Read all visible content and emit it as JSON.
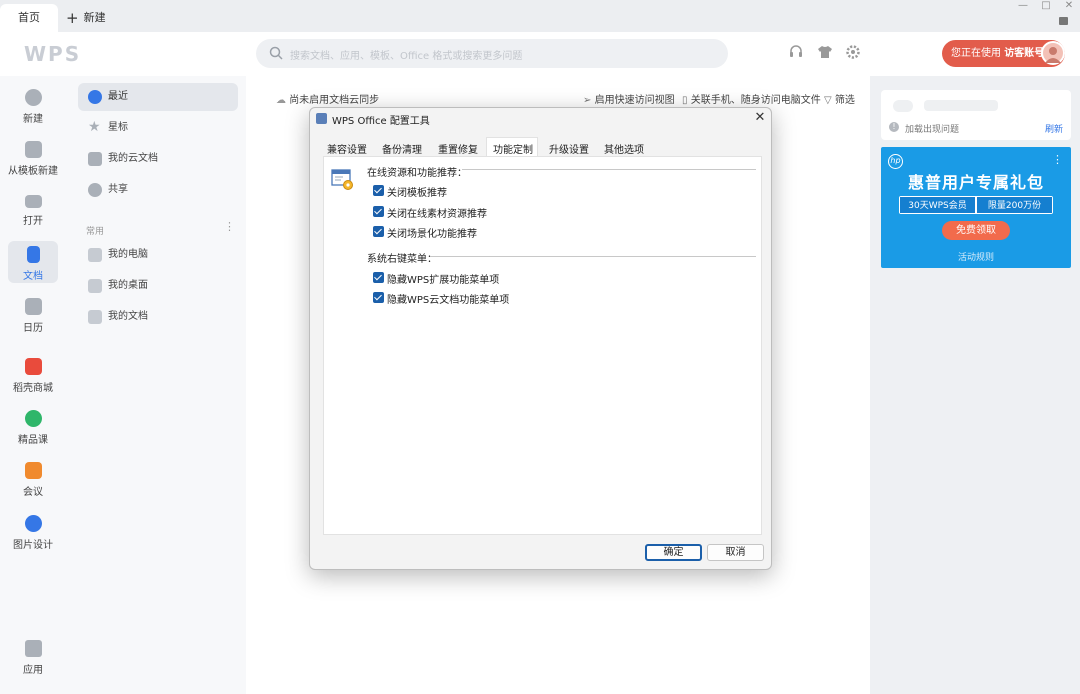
{
  "tabs": {
    "home": "首页",
    "new": "新建"
  },
  "header": {
    "logo": "WPS",
    "search_placeholder": "搜索文档、应用、模板、Office 格式或搜索更多问题",
    "user_status": "您正在使用",
    "user_account": "访客账号"
  },
  "rail": {
    "items": [
      {
        "label": "新建",
        "color": "#aab0b8"
      },
      {
        "label": "从模板新建",
        "color": "#aab0b8"
      },
      {
        "label": "打开",
        "color": "#aab0b8"
      },
      {
        "label": "文档",
        "color": "#3577e6"
      },
      {
        "label": "日历",
        "color": "#aab0b8"
      },
      {
        "label": "稻壳商城",
        "color": "#e94b3c"
      },
      {
        "label": "精品课",
        "color": "#2fb66a"
      },
      {
        "label": "会议",
        "color": "#f08a2e"
      },
      {
        "label": "图片设计",
        "color": "#3577e6"
      },
      {
        "label": "应用",
        "color": "#aab0b8"
      }
    ]
  },
  "nav": {
    "items": [
      {
        "label": "最近"
      },
      {
        "label": "星标"
      },
      {
        "label": "我的云文档"
      },
      {
        "label": "共享"
      }
    ],
    "section": "常用",
    "common": [
      {
        "label": "我的电脑"
      },
      {
        "label": "我的桌面"
      },
      {
        "label": "我的文档"
      }
    ]
  },
  "main": {
    "sync_text": "尚未启用文档云同步",
    "quick_access": "启用快速访问视图",
    "phone_link": "关联手机、随身访问电脑文件",
    "filter": "筛选"
  },
  "right": {
    "load_error": "加载出现问题",
    "refresh": "刷新",
    "banner_title": "惠普用户专属礼包",
    "banner_offer_left": "30天WPS会员",
    "banner_offer_right": "限量200万份",
    "banner_button": "免费领取",
    "banner_rules": "活动规则"
  },
  "dialog": {
    "title": "WPS Office 配置工具",
    "tabs": [
      "兼容设置",
      "备份清理",
      "重置修复",
      "功能定制",
      "升级设置",
      "其他选项"
    ],
    "active_tab": "功能定制",
    "section1": "在线资源和功能推荐：",
    "section1_items": [
      "关闭模板推荐",
      "关闭在线素材资源推荐",
      "关闭场景化功能推荐"
    ],
    "section2": "系统右键菜单：",
    "section2_items": [
      "隐藏WPS扩展功能菜单项",
      "隐藏WPS云文档功能菜单项"
    ],
    "ok": "确定",
    "cancel": "取消"
  },
  "colors": {
    "accent": "#1b5faa",
    "user_pill": "#e25c4b",
    "banner": "#1a9be6"
  }
}
